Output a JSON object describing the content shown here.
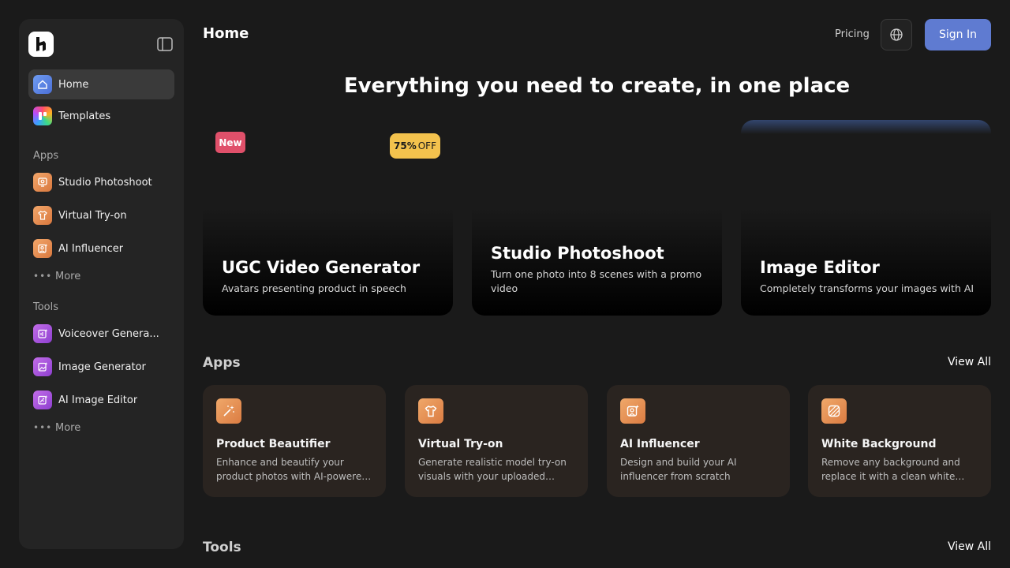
{
  "header": {
    "title": "Home",
    "pricing": "Pricing",
    "signin": "Sign In"
  },
  "sidebar": {
    "top_items": [
      {
        "label": "Home",
        "icon": "home-icon",
        "active": true
      },
      {
        "label": "Templates",
        "icon": "templates-icon",
        "active": false
      }
    ],
    "apps_label": "Apps",
    "apps": [
      {
        "label": "Studio Photoshoot",
        "icon": "photoshoot-icon"
      },
      {
        "label": "Virtual Try-on",
        "icon": "shirt-icon"
      },
      {
        "label": "AI Influencer",
        "icon": "influencer-icon"
      }
    ],
    "apps_more": "More",
    "tools_label": "Tools",
    "tools": [
      {
        "label": "Voiceover Genera...",
        "icon": "voiceover-icon"
      },
      {
        "label": "Image Generator",
        "icon": "image-generator-icon"
      },
      {
        "label": "AI Image Editor",
        "icon": "image-editor-icon"
      }
    ],
    "tools_more": "More"
  },
  "hero": {
    "heading": "Everything you need to create, in one place",
    "cards": [
      {
        "title": "UGC Video Generator",
        "description": "Avatars presenting product in speech",
        "badge": "New"
      },
      {
        "title": "Studio Photoshoot",
        "description": "Turn one photo into 8 scenes with a promo video",
        "badge_strong": "75%",
        "badge_rest": "OFF"
      },
      {
        "title": "Image Editor",
        "description": "Completely transforms your images with AI"
      }
    ]
  },
  "apps_section": {
    "heading": "Apps",
    "view_all": "View All",
    "cards": [
      {
        "title": "Product Beautifier",
        "description": "Enhance and beautify your product photos with AI-powered enhancements",
        "icon": "magic-wand-icon"
      },
      {
        "title": "Virtual Try-on",
        "description": "Generate realistic model try-on visuals with your uploaded garments",
        "icon": "shirt-icon"
      },
      {
        "title": "AI Influencer",
        "description": "Design and build your AI influencer from scratch",
        "icon": "influencer-icon"
      },
      {
        "title": "White Background",
        "description": "Remove any background and replace it with a clean white backdrop",
        "icon": "hatch-icon"
      }
    ]
  },
  "tools_section": {
    "heading": "Tools",
    "view_all": "View All"
  },
  "colors": {
    "background": "#1a1a1a",
    "sidebar": "#242424",
    "accent": "#5f7bd1",
    "new_badge": "#e0506a",
    "discount_badge": "#f3c24d",
    "app_icon": "#e08a4c",
    "tool_icon": "#a552dc"
  }
}
